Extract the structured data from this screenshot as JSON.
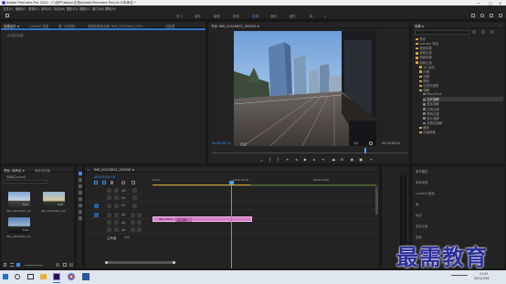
{
  "window": {
    "title": "Adobe Premiere Pro 2020 - C:\\用户\\bbiao\\文档\\Adobe\\Premiere Pro\\14.0\\未命名 *",
    "controls": [
      "—",
      "□",
      "✕"
    ]
  },
  "menu": [
    "文件(F)",
    "编辑(E)",
    "剪辑(C)",
    "序列(S)",
    "标记(M)",
    "图形(G)",
    "视图(V)",
    "窗口(W)",
    "帮助(H)"
  ],
  "workspaces": {
    "items": [
      "学习",
      "组件",
      "编辑",
      "颜色",
      "效果",
      "音频",
      "图形",
      "库"
    ],
    "active_index": 4
  },
  "source_panel": {
    "tabs": [
      "效果控件 ≡",
      "Lumetri 范围",
      "源: (无剪辑)",
      "音频剪辑混合器: IMG_20210812_190...",
      "元数据"
    ],
    "active_tab": 0,
    "placeholder": "(未选择剪辑)"
  },
  "program_monitor": {
    "tab_label": "节目: IMG_20210812_190355 ≡",
    "timecode_left": "00:00:04:16",
    "fit_label": "适合",
    "quality_label": "1/2",
    "timecode_right": "00:00:05:21"
  },
  "project_panel": {
    "tabs": [
      "项目: 未命名 ≡",
      "媒体浏览器"
    ],
    "filename": "未命名.prproj",
    "search_placeholder": "",
    "clips": [
      {
        "name": "IMG_20210812_19...",
        "duration": "5:21"
      },
      {
        "name": "IMG_20210812_18...",
        "duration": "5:22"
      },
      {
        "name": "IMG_20210812_19...",
        "duration": "5:10"
      }
    ]
  },
  "timeline": {
    "tab_label": "IMG_20210812_190355 ≡",
    "timecode": "00:00:04:16",
    "ruler_labels": [
      "00:00",
      "00:00:05:00",
      "00:00:10:00"
    ],
    "video_tracks": [
      "V3",
      "V2",
      "V1"
    ],
    "audio_tracks": [
      "A1",
      "A2",
      "A3"
    ],
    "master_label": "主声道",
    "master_value": "0.0",
    "clip_label": "IMG_20210...",
    "transition_label": "交叉溶解"
  },
  "effects_panel": {
    "tab_label": "效果 ≡",
    "tree": [
      {
        "label": "预设",
        "indent": 0
      },
      {
        "label": "Lumetri 预设",
        "indent": 0
      },
      {
        "label": "音频效果",
        "indent": 0
      },
      {
        "label": "音频过渡",
        "indent": 0
      },
      {
        "label": "视频效果",
        "indent": 0
      },
      {
        "label": "视频过渡",
        "indent": 0
      },
      {
        "label": "3D 运动",
        "indent": 1
      },
      {
        "label": "内滑",
        "indent": 1
      },
      {
        "label": "划像",
        "indent": 1
      },
      {
        "label": "擦除",
        "indent": 1
      },
      {
        "label": "沉浸式视频",
        "indent": 1
      },
      {
        "label": "溶解",
        "indent": 1
      },
      {
        "label": "MorphCut",
        "indent": 2
      },
      {
        "label": "交叉溶解",
        "indent": 2
      },
      {
        "label": "叠加溶解",
        "indent": 2
      },
      {
        "label": "白场过渡",
        "indent": 2
      },
      {
        "label": "黑场过渡",
        "indent": 2
      },
      {
        "label": "胶片溶解",
        "indent": 2
      },
      {
        "label": "非叠加溶解",
        "indent": 2
      },
      {
        "label": "缩放",
        "indent": 1
      },
      {
        "label": "页面剥落",
        "indent": 1
      }
    ],
    "bottom_list": [
      "基本图形",
      "基本声音",
      "Lumetri 颜色",
      "库",
      "标记",
      "历史记录",
      "信息"
    ]
  },
  "watermark": "最需教育",
  "taskbar": {
    "time": "11:25",
    "date": "2021/7/26"
  },
  "colors": {
    "accent_blue": "#3b95ff",
    "clip_pink": "#d77fc8",
    "playhead": "#4aa3ff",
    "work_area": "#c9a227",
    "watermark": "#2b2f9e"
  }
}
